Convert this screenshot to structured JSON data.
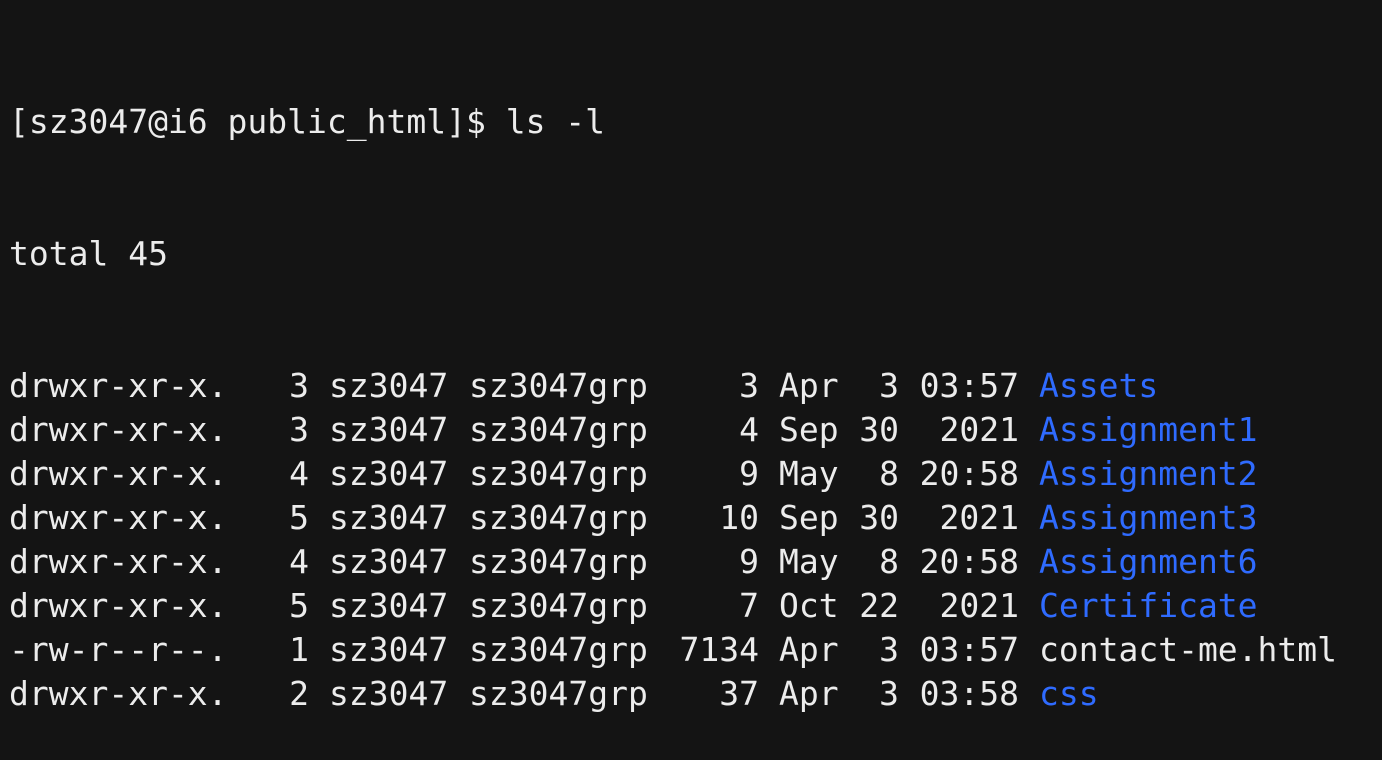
{
  "terminal": {
    "prompt": "[sz3047@i6 public_html]$ ",
    "command": "ls -l",
    "total_line": "total 45",
    "colors": {
      "background": "#141414",
      "text": "#ececec",
      "directory": "#2f6bff"
    },
    "entries": [
      {
        "perm": "drwxr-xr-x.",
        "links": "3",
        "owner": "sz3047",
        "group": "sz3047grp",
        "size": "3",
        "month": "Apr",
        "day": "3",
        "time": "03:57",
        "name": "Assets",
        "type": "directory"
      },
      {
        "perm": "drwxr-xr-x.",
        "links": "3",
        "owner": "sz3047",
        "group": "sz3047grp",
        "size": "4",
        "month": "Sep",
        "day": "30",
        "time": "2021",
        "name": "Assignment1",
        "type": "directory"
      },
      {
        "perm": "drwxr-xr-x.",
        "links": "4",
        "owner": "sz3047",
        "group": "sz3047grp",
        "size": "9",
        "month": "May",
        "day": "8",
        "time": "20:58",
        "name": "Assignment2",
        "type": "directory"
      },
      {
        "perm": "drwxr-xr-x.",
        "links": "5",
        "owner": "sz3047",
        "group": "sz3047grp",
        "size": "10",
        "month": "Sep",
        "day": "30",
        "time": "2021",
        "name": "Assignment3",
        "type": "directory"
      },
      {
        "perm": "drwxr-xr-x.",
        "links": "4",
        "owner": "sz3047",
        "group": "sz3047grp",
        "size": "9",
        "month": "May",
        "day": "8",
        "time": "20:58",
        "name": "Assignment6",
        "type": "directory"
      },
      {
        "perm": "drwxr-xr-x.",
        "links": "5",
        "owner": "sz3047",
        "group": "sz3047grp",
        "size": "7",
        "month": "Oct",
        "day": "22",
        "time": "2021",
        "name": "Certificate",
        "type": "directory"
      },
      {
        "perm": "-rw-r--r--.",
        "links": "1",
        "owner": "sz3047",
        "group": "sz3047grp",
        "size": "7134",
        "month": "Apr",
        "day": "3",
        "time": "03:57",
        "name": "contact-me.html",
        "type": "file"
      },
      {
        "perm": "drwxr-xr-x.",
        "links": "2",
        "owner": "sz3047",
        "group": "sz3047grp",
        "size": "37",
        "month": "Apr",
        "day": "3",
        "time": "03:58",
        "name": "css",
        "type": "directory"
      }
    ]
  }
}
